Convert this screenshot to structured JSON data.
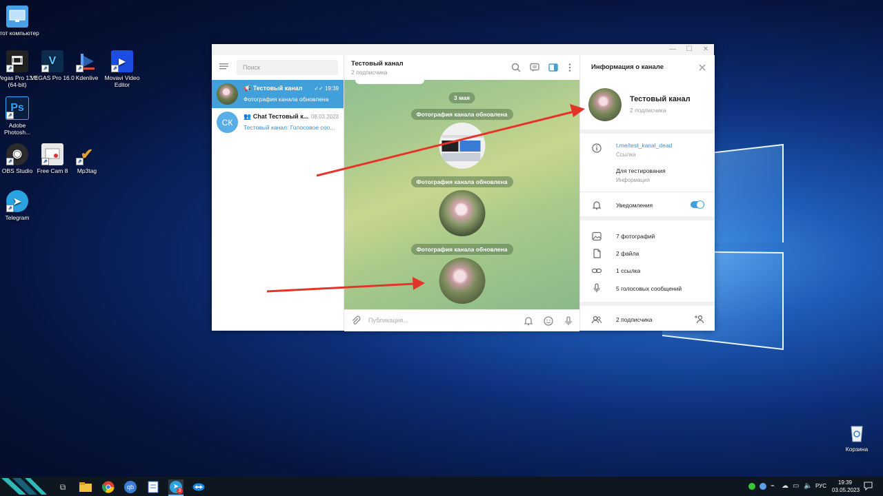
{
  "desktop": {
    "icons": [
      {
        "label": "Этот компьютер",
        "icon": "computer-icon",
        "color": "#4aa0e6"
      },
      {
        "label": "Vegas Pro 13.0 (64-bit)",
        "icon": "film-icon",
        "color": "#222222"
      },
      {
        "label": "VEGAS Pro 16.0",
        "icon": "vegas-icon",
        "color": "#0b2c4e"
      },
      {
        "label": "Kdenlive",
        "icon": "kdenlive-icon",
        "color": "#2a5ea8"
      },
      {
        "label": "Movavi Video Editor",
        "icon": "movavi-icon",
        "color": "#1b4de0"
      },
      {
        "label": "Adobe Photosh...",
        "icon": "photoshop-icon",
        "color": "#0a1e3f"
      },
      {
        "label": "OBS Studio",
        "icon": "obs-icon",
        "color": "#2b2b2b"
      },
      {
        "label": "Free Cam 8",
        "icon": "freecam-icon",
        "color": "#e8e8e8"
      },
      {
        "label": "Mp3tag",
        "icon": "mp3tag-icon",
        "color": "#e0a030"
      },
      {
        "label": "Telegram",
        "icon": "telegram-icon",
        "color": "#2aa3e0"
      },
      {
        "label": "Корзина",
        "icon": "recycle-bin-icon",
        "color": "#dfe7ef"
      }
    ]
  },
  "telegram": {
    "window_controls": {
      "minimize": "—",
      "maximize": "☐",
      "close": "✕"
    },
    "search": {
      "placeholder": "Поиск"
    },
    "chats": [
      {
        "name": "Тестовый канал",
        "time": "19:39",
        "preview": "Фотография канала обновлена",
        "active": true
      },
      {
        "name": "Chat Тестовый к...",
        "time": "08.03.2023",
        "preview": "Тестовый канал: Голосовое соо...",
        "initials": "СК",
        "active": false
      }
    ],
    "chat_header": {
      "title": "Тестовый канал",
      "subtitle": "2 подписчика"
    },
    "messages": {
      "date_pill": "3 мая",
      "service": [
        "Фотография канала обновлена",
        "Фотография канала обновлена",
        "Фотография канала обновлена"
      ]
    },
    "composer": {
      "placeholder": "Публикация..."
    },
    "info_panel": {
      "title": "Информация о канале",
      "channel_name": "Тестовый канал",
      "channel_subs": "2 подписчика",
      "link": "t.me/test_kanal_dead",
      "link_label": "Ссылка",
      "description": "Для тестирования",
      "description_label": "Информация",
      "notifications": "Уведомления",
      "notifications_on": true,
      "media": [
        "7 фотографий",
        "2 файла",
        "1 ссылка",
        "5 голосовых сообщений"
      ],
      "members": "2 подписчика"
    },
    "accent_color": "#419fd9"
  },
  "taskbar": {
    "tray": {
      "lang": "РУС",
      "time": "19:39",
      "date": "03.05.2023"
    },
    "telegram_badge": "3"
  }
}
